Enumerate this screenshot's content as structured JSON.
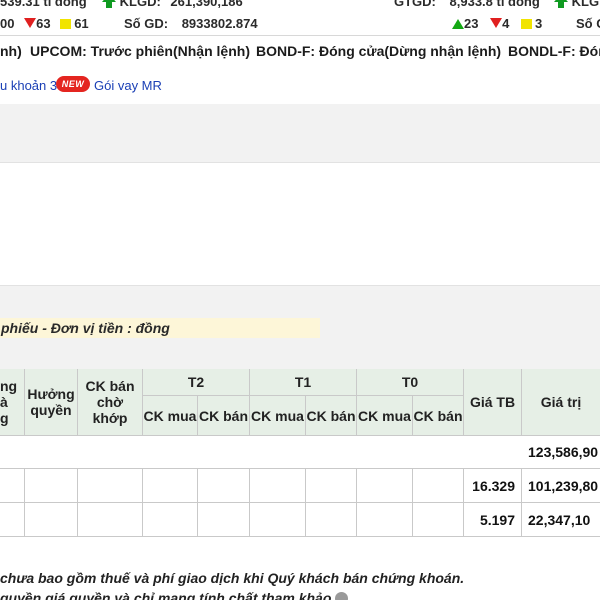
{
  "ticker": {
    "left_value_text": "539.31 tỉ đồng",
    "left_klgd_label": "KLGD:",
    "left_klgd_value": "261,390,186",
    "left_up_count": "00",
    "left_down_count": "63",
    "left_ref_count": "61",
    "left_sogd_label": "Số GD:",
    "left_sogd_value": "8933802.874",
    "right_gtgd_label": "GTGD:",
    "right_gtgd_value": "8,933.8 tỉ đồng",
    "right_up_count": "23",
    "right_down_count": "4",
    "right_ref_count": "3",
    "right_klg_label": "KLG",
    "right_sog_label": "Số G"
  },
  "status_line": {
    "item1": "nh)",
    "item2": "UPCOM: Trước phiên(Nhận lệnh)",
    "item3": "BOND-F: Đóng cửa(Dừng nhận lệnh)",
    "item4": "BONDL-F: Đón"
  },
  "links": {
    "account_link": "u khoản 3",
    "new_badge": "NEW",
    "loan_link": "Gói vay MR"
  },
  "caption": "phiếu - Đơn vị tiền : đồng",
  "table": {
    "headers": {
      "col_partial": "ng\nà\ng",
      "rights": "Hưởng quyền",
      "pending_sell": "CK bán chờ khớp",
      "t2": "T2",
      "t1": "T1",
      "t0": "T0",
      "ck_buy": "CK mua",
      "ck_sell": "CK bán",
      "avg_price": "Giá TB",
      "value": "Giá trị"
    },
    "rows": [
      {
        "avg_price": "",
        "value": "123,586,90"
      },
      {
        "avg_price": "16.329",
        "value": "101,239,80"
      },
      {
        "avg_price": "5.197",
        "value": "22,347,10"
      }
    ]
  },
  "notes": {
    "line1": "chưa bao gồm thuế và phí giao dịch khi Quý khách bán chứng khoán.",
    "line2": "quyền giá quyền và chỉ mang tính chất tham khảo"
  }
}
